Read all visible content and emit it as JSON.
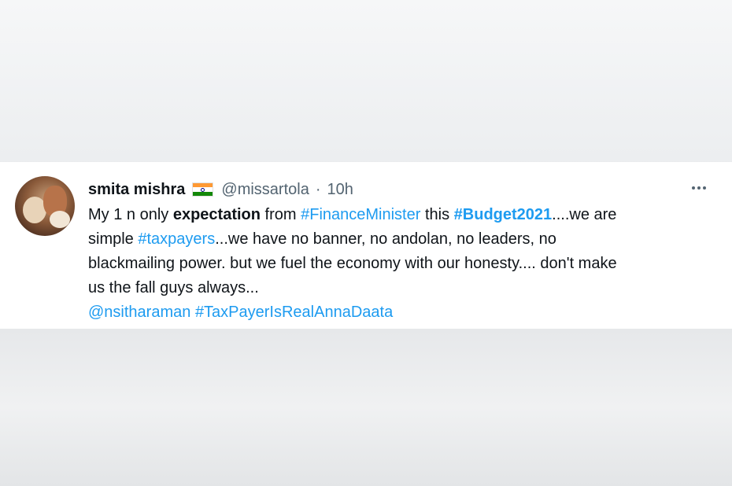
{
  "tweet": {
    "author": {
      "name": "smita mishra",
      "handle": "@missartola",
      "separator": "·",
      "time": "10h"
    },
    "flag_icon": "india-flag-icon",
    "more_icon": "more-options-icon",
    "text": {
      "l1_a": "My 1 n only ",
      "l1_b": "expectation",
      "l1_c": " from ",
      "l1_tag1": "#FinanceMinister",
      "l1_d": " this ",
      "l1_tag2": "#Budget2021",
      "l1_e": "....we are",
      "l2_a": "simple ",
      "l2_tag": "#taxpayers",
      "l2_b": "...we have no banner, no andolan, no leaders, no",
      "l3": "blackmailing power. but we fuel the economy with our honesty.... don't make",
      "l4": "us the fall guys always...",
      "mention": "@nsitharaman",
      "l5_sep": " ",
      "tag_final": "#TaxPayerIsRealAnnaDaata"
    }
  },
  "colors": {
    "link": "#1d9bf0",
    "text": "#0f1419",
    "muted": "#536471",
    "card": "#ffffff",
    "background": "#eceef0"
  }
}
